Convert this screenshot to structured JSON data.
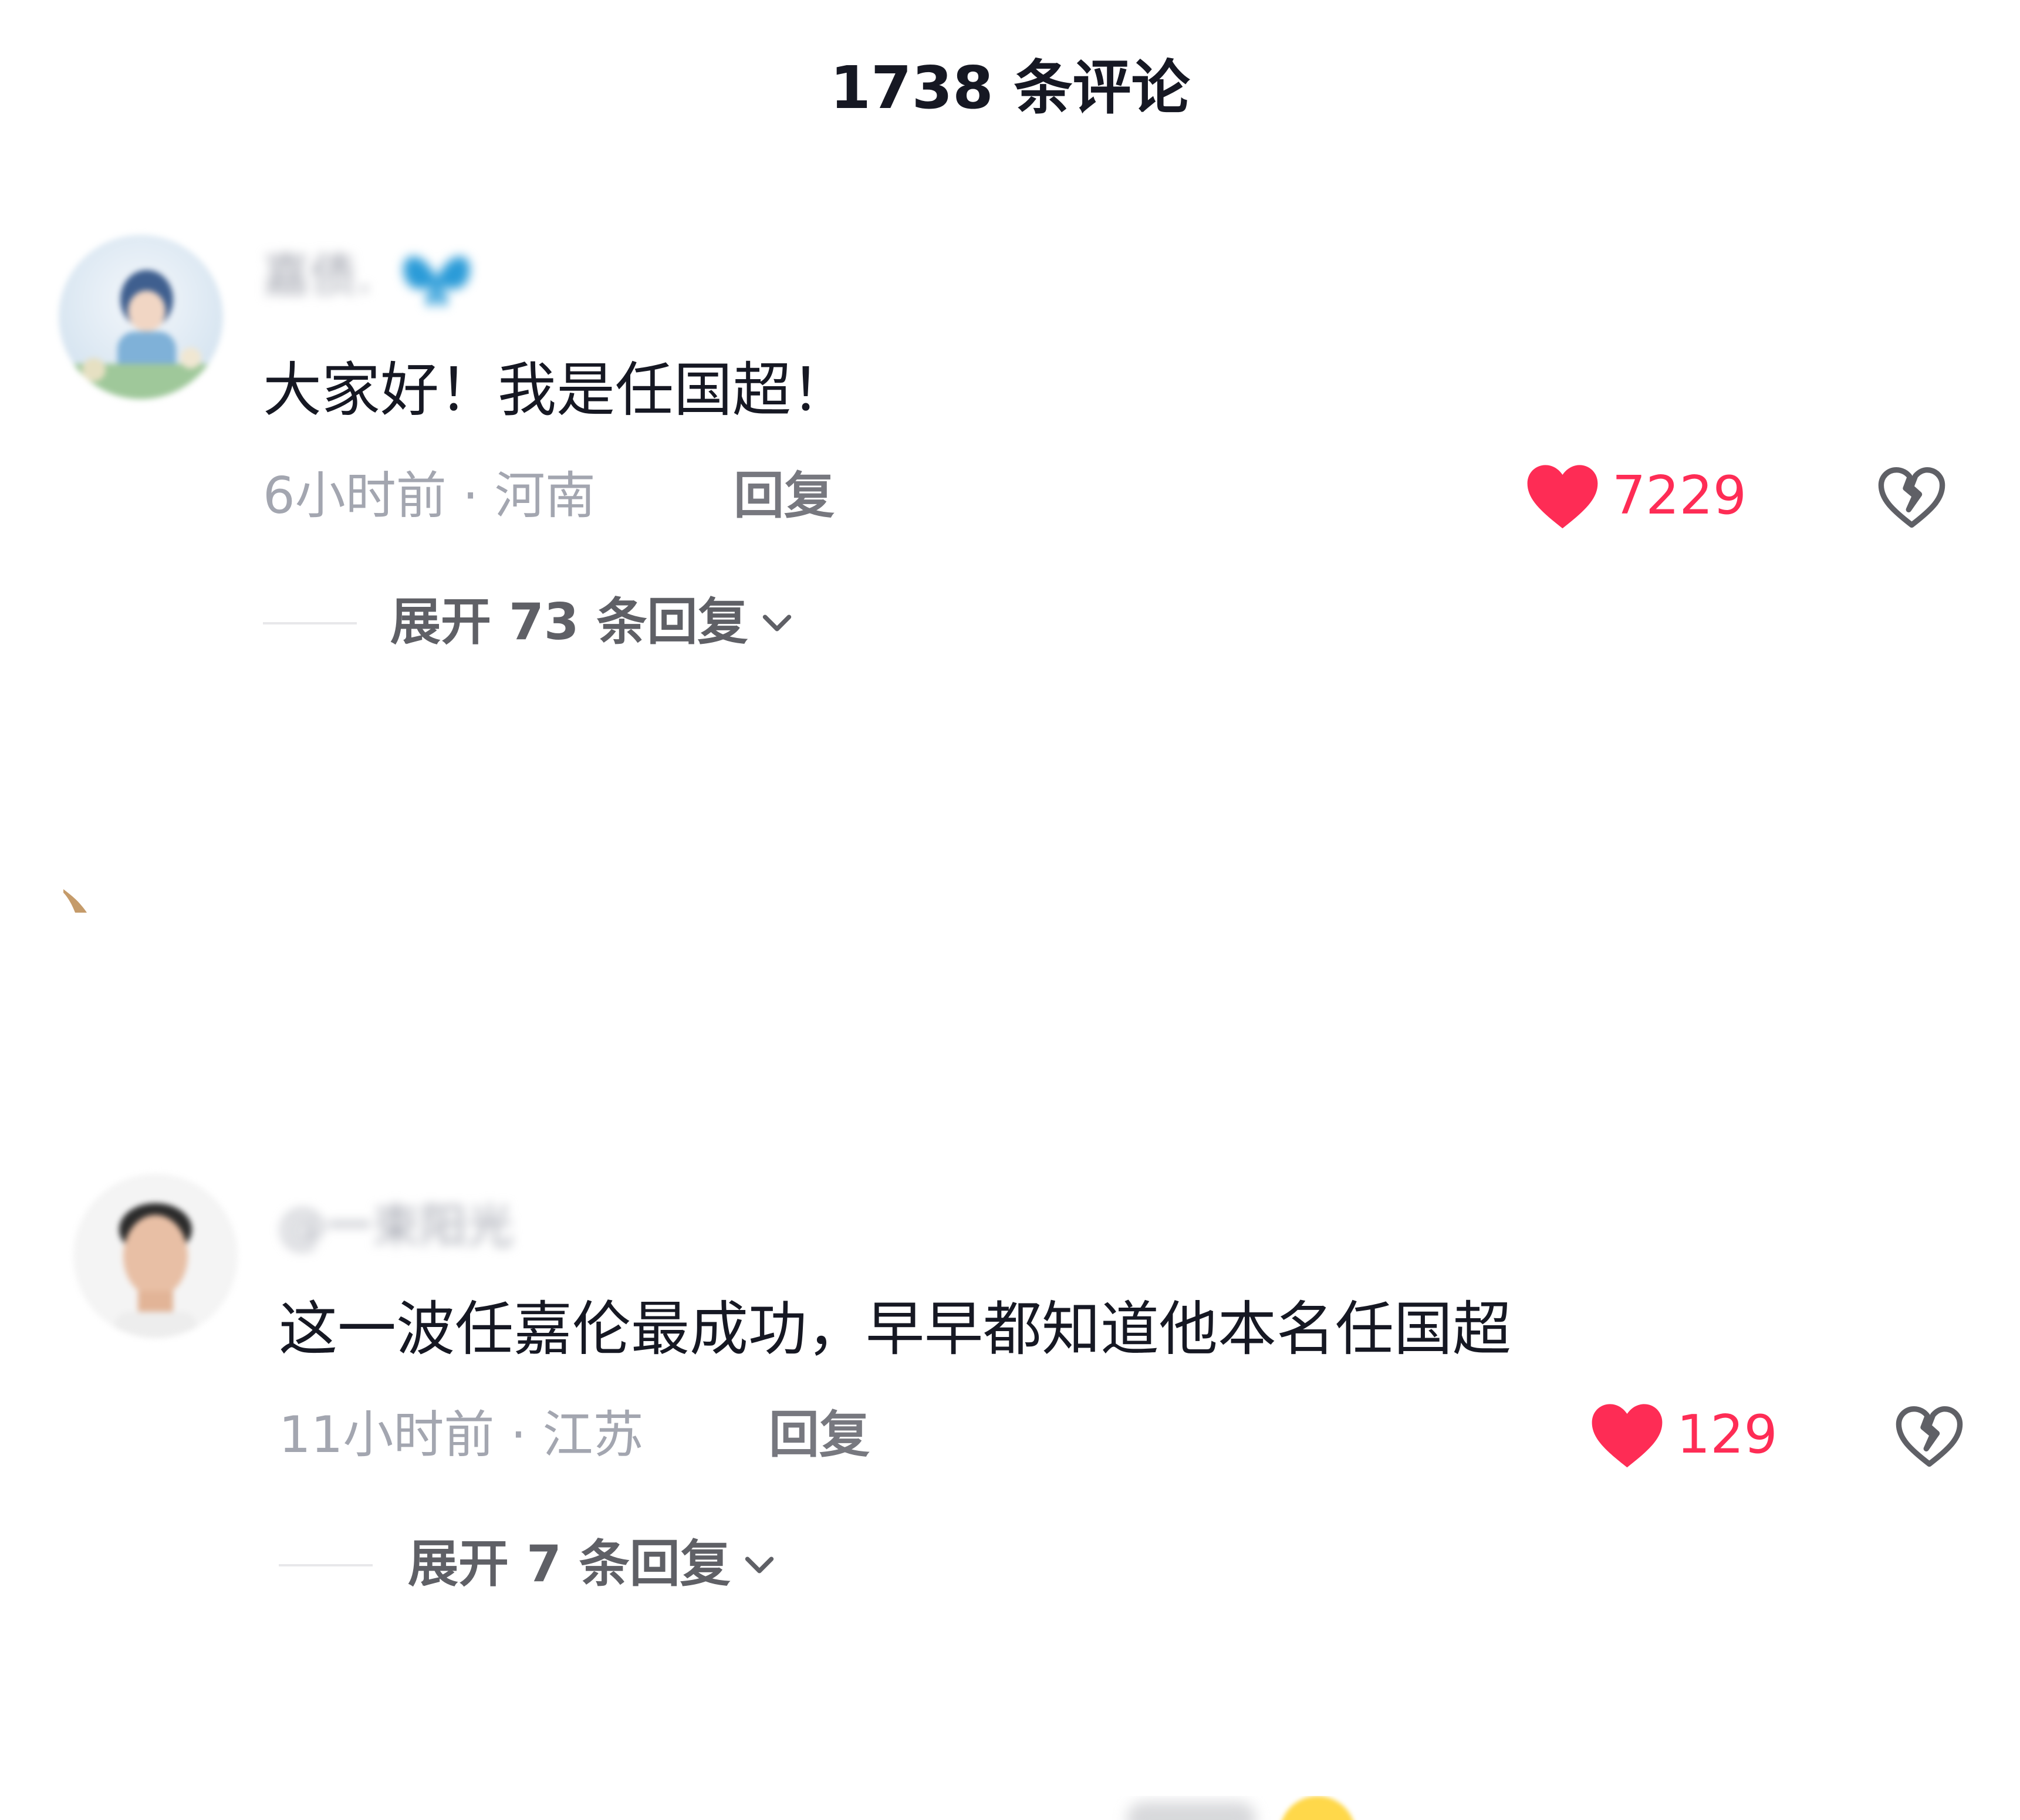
{
  "header": {
    "title": "1738 条评论"
  },
  "comments": [
    {
      "username": "嘉债.",
      "badge_icon": "butterfly-icon",
      "text": "大家好！我是任国超！",
      "meta": "6小时前 · 河南",
      "reply_label": "回复",
      "like_icon": "heart-icon",
      "likes": "7229",
      "dislike_icon": "broken-heart-icon",
      "expand_label": "展开 73 条回复"
    },
    {
      "username": "@一束阳光",
      "text": "这一波任嘉伦最成功，早早都知道他本名任国超",
      "meta": "11小时前 · 江苏",
      "reply_label": "回复",
      "like_icon": "heart-icon",
      "likes": "129",
      "dislike_icon": "broken-heart-icon",
      "expand_label": "展开 7 条回复"
    }
  ],
  "colors": {
    "like": "#fe2c55",
    "muted": "#a3a6b0",
    "text": "#161823"
  }
}
